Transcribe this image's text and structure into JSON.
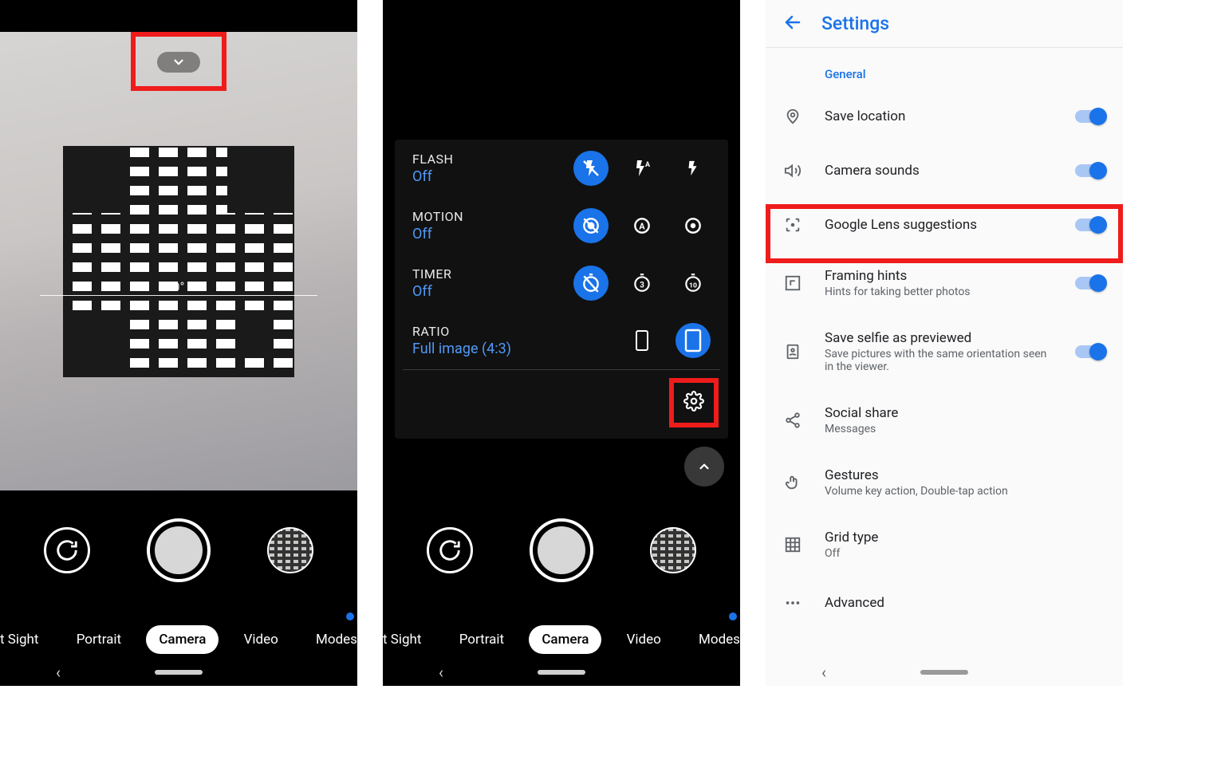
{
  "screen1": {
    "level_text": "0°",
    "modes": [
      "t Sight",
      "Portrait",
      "Camera",
      "Video",
      "Modes"
    ],
    "active_mode_index": 2
  },
  "screen2": {
    "panel": {
      "flash": {
        "label": "FLASH",
        "value": "Off"
      },
      "motion": {
        "label": "MOTION",
        "value": "Off"
      },
      "timer": {
        "label": "TIMER",
        "value": "Off"
      },
      "ratio": {
        "label": "RATIO",
        "value": "Full image (4:3)"
      }
    },
    "modes": [
      "t Sight",
      "Portrait",
      "Camera",
      "Video",
      "Modes"
    ],
    "active_mode_index": 2
  },
  "screen3": {
    "title": "Settings",
    "section": "General",
    "items": {
      "save_location": {
        "primary": "Save location",
        "toggle": true
      },
      "camera_sounds": {
        "primary": "Camera sounds",
        "toggle": true
      },
      "lens": {
        "primary": "Google Lens suggestions",
        "toggle": true
      },
      "framing": {
        "primary": "Framing hints",
        "secondary": "Hints for taking better photos",
        "toggle": true
      },
      "selfie": {
        "primary": "Save selfie as previewed",
        "secondary": "Save pictures with the same orientation seen in the viewer.",
        "toggle": true
      },
      "social": {
        "primary": "Social share",
        "secondary": "Messages"
      },
      "gestures": {
        "primary": "Gestures",
        "secondary": "Volume key action, Double-tap action"
      },
      "grid": {
        "primary": "Grid type",
        "secondary": "Off"
      },
      "advanced": {
        "primary": "Advanced"
      }
    }
  }
}
